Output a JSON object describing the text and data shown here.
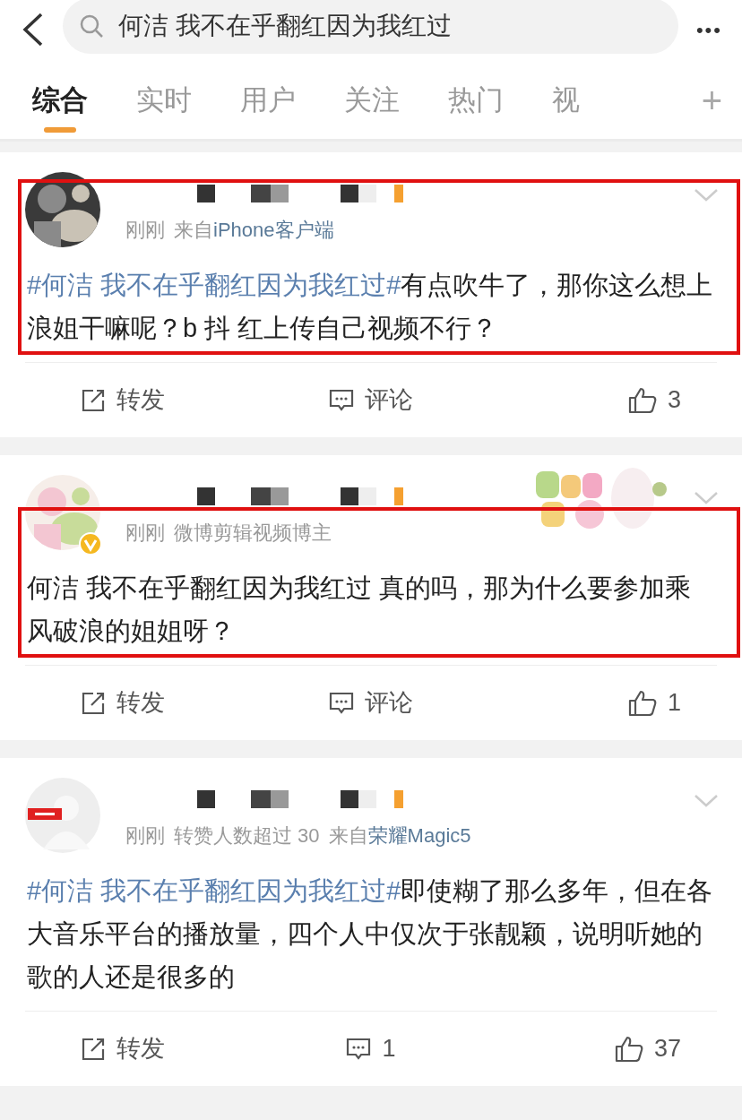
{
  "search": {
    "query": "何洁 我不在乎翻红因为我红过"
  },
  "more_button": "•••",
  "tabs": [
    {
      "label": "综合",
      "selected": true
    },
    {
      "label": "实时",
      "selected": false
    },
    {
      "label": "用户",
      "selected": false
    },
    {
      "label": "关注",
      "selected": false
    },
    {
      "label": "热门",
      "selected": false
    },
    {
      "label": "视",
      "selected": false
    }
  ],
  "add_tab": "+",
  "posts": [
    {
      "verified": false,
      "banner": false,
      "highlighted": true,
      "time": "刚刚",
      "source_prefix": "来自",
      "source": "iPhone客户端",
      "hashtag": "#何洁 我不在乎翻红因为我红过#",
      "text": "有点吹牛了，那你这么想上浪姐干嘛呢？b 抖 红上传自己视频不行？",
      "repost": "转发",
      "comment": "评论",
      "likes": "3"
    },
    {
      "verified": true,
      "banner": true,
      "highlighted": true,
      "time": "刚刚",
      "note": "微博剪辑视频博主",
      "text": "何洁 我不在乎翻红因为我红过 真的吗，那为什么要参加乘风破浪的姐姐呀？",
      "repost": "转发",
      "comment": "评论",
      "likes": "1"
    },
    {
      "kind": "default",
      "verified": false,
      "banner": false,
      "highlighted": false,
      "time": "刚刚",
      "note": "转赞人数超过 30",
      "source_prefix": "来自",
      "source": "荣耀Magic5",
      "hashtag": "#何洁 我不在乎翻红因为我红过#",
      "text": "即使糊了那么多年，但在各大音乐平台的播放量，四个人中仅次于张靓颖，说明听她的歌的人还是很多的",
      "repost": "转发",
      "comment": "1",
      "likes": "37"
    }
  ]
}
